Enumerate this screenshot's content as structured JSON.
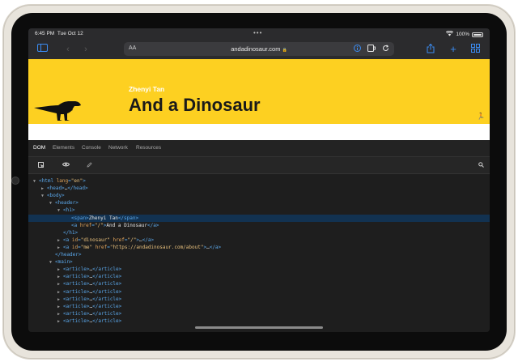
{
  "status": {
    "time": "6:45 PM",
    "date": "Tue Oct 12",
    "battery": "100%"
  },
  "browser": {
    "text_size": "AA",
    "url": "andadinosaur.com",
    "lock": "🔒"
  },
  "site": {
    "author": "Zhenyi Tan",
    "title": "And a Dinosaur"
  },
  "inspector": {
    "tabs": [
      "DOM",
      "Elements",
      "Console",
      "Network",
      "Resources"
    ],
    "active_tab": "DOM"
  },
  "dom": [
    {
      "depth": 0,
      "tri": "down",
      "parts": [
        [
          "tag",
          "<html "
        ],
        [
          "attr",
          "lang"
        ],
        [
          "tag",
          "="
        ],
        [
          "val",
          "\"en\""
        ],
        [
          "tag",
          ">"
        ]
      ]
    },
    {
      "depth": 1,
      "tri": "right",
      "parts": [
        [
          "tag",
          "<head>"
        ],
        [
          "txt",
          "…"
        ],
        [
          "tag",
          "</head>"
        ]
      ]
    },
    {
      "depth": 1,
      "tri": "down",
      "parts": [
        [
          "tag",
          "<body>"
        ]
      ]
    },
    {
      "depth": 2,
      "tri": "down",
      "parts": [
        [
          "tag",
          "<header>"
        ]
      ]
    },
    {
      "depth": 3,
      "tri": "down",
      "parts": [
        [
          "tag",
          "<h1>"
        ]
      ]
    },
    {
      "depth": 4,
      "tri": "none",
      "sel": true,
      "parts": [
        [
          "tag",
          "<span>"
        ],
        [
          "txt",
          "Zhenyi Tan"
        ],
        [
          "tag",
          "</span>"
        ]
      ]
    },
    {
      "depth": 4,
      "tri": "none",
      "parts": [
        [
          "tag",
          "<a "
        ],
        [
          "attr",
          "href"
        ],
        [
          "tag",
          "="
        ],
        [
          "val",
          "\"/\""
        ],
        [
          "tag",
          ">"
        ],
        [
          "txt",
          "And a Dinosaur"
        ],
        [
          "tag",
          "</a>"
        ]
      ]
    },
    {
      "depth": 3,
      "tri": "none",
      "parts": [
        [
          "tag",
          "</h1>"
        ]
      ]
    },
    {
      "depth": 3,
      "tri": "right",
      "parts": [
        [
          "tag",
          "<a "
        ],
        [
          "attr",
          "id"
        ],
        [
          "tag",
          "="
        ],
        [
          "val",
          "\"dinosaur\""
        ],
        [
          "tag",
          " "
        ],
        [
          "attr",
          "href"
        ],
        [
          "tag",
          "="
        ],
        [
          "val",
          "\"/\""
        ],
        [
          "tag",
          ">"
        ],
        [
          "txt",
          "…"
        ],
        [
          "tag",
          "</a>"
        ]
      ]
    },
    {
      "depth": 3,
      "tri": "right",
      "parts": [
        [
          "tag",
          "<a "
        ],
        [
          "attr",
          "id"
        ],
        [
          "tag",
          "="
        ],
        [
          "val",
          "\"me\""
        ],
        [
          "tag",
          " "
        ],
        [
          "attr",
          "href"
        ],
        [
          "tag",
          "="
        ],
        [
          "val",
          "\"https://andadinosaur.com/about\""
        ],
        [
          "tag",
          ">"
        ],
        [
          "txt",
          "…"
        ],
        [
          "tag",
          "</a>"
        ]
      ]
    },
    {
      "depth": 2,
      "tri": "none",
      "parts": [
        [
          "tag",
          "</header>"
        ]
      ]
    },
    {
      "depth": 2,
      "tri": "down",
      "parts": [
        [
          "tag",
          "<main>"
        ]
      ]
    },
    {
      "depth": 3,
      "tri": "right",
      "parts": [
        [
          "tag",
          "<article>"
        ],
        [
          "txt",
          "…"
        ],
        [
          "tag",
          "</article>"
        ]
      ]
    },
    {
      "depth": 3,
      "tri": "right",
      "parts": [
        [
          "tag",
          "<article>"
        ],
        [
          "txt",
          "…"
        ],
        [
          "tag",
          "</article>"
        ]
      ]
    },
    {
      "depth": 3,
      "tri": "right",
      "parts": [
        [
          "tag",
          "<article>"
        ],
        [
          "txt",
          "…"
        ],
        [
          "tag",
          "</article>"
        ]
      ]
    },
    {
      "depth": 3,
      "tri": "right",
      "parts": [
        [
          "tag",
          "<article>"
        ],
        [
          "txt",
          "…"
        ],
        [
          "tag",
          "</article>"
        ]
      ]
    },
    {
      "depth": 3,
      "tri": "right",
      "parts": [
        [
          "tag",
          "<article>"
        ],
        [
          "txt",
          "…"
        ],
        [
          "tag",
          "</article>"
        ]
      ]
    },
    {
      "depth": 3,
      "tri": "right",
      "parts": [
        [
          "tag",
          "<article>"
        ],
        [
          "txt",
          "…"
        ],
        [
          "tag",
          "</article>"
        ]
      ]
    },
    {
      "depth": 3,
      "tri": "right",
      "parts": [
        [
          "tag",
          "<article>"
        ],
        [
          "txt",
          "…"
        ],
        [
          "tag",
          "</article>"
        ]
      ]
    },
    {
      "depth": 3,
      "tri": "right",
      "parts": [
        [
          "tag",
          "<article>"
        ],
        [
          "txt",
          "…"
        ],
        [
          "tag",
          "</article>"
        ]
      ]
    }
  ],
  "colors": {
    "accent": "#3b8cf2",
    "site_yellow": "#fdd021",
    "selection": "#123251"
  }
}
